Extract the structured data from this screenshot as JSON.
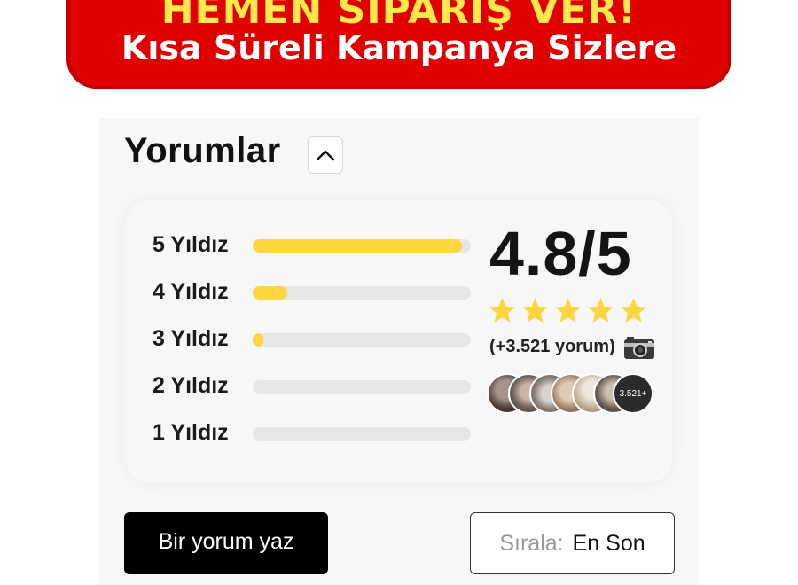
{
  "banner": {
    "line1": "HEMEN SİPARİŞ VER!",
    "line2": "Kısa Süreli Kampanya Sizlere"
  },
  "reviews": {
    "title": "Yorumlar",
    "collapse_icon": "chevron-up-icon",
    "rating_rows": [
      {
        "label": "5 Yıldız",
        "fill_fraction": 0.96
      },
      {
        "label": "4 Yıldız",
        "fill_fraction": 0.16
      },
      {
        "label": "3 Yıldız",
        "fill_fraction": 0.05
      },
      {
        "label": "2 Yıldız",
        "fill_fraction": 0.0
      },
      {
        "label": "1 Yıldız",
        "fill_fraction": 0.0
      }
    ],
    "score": "4.8/5",
    "star_count": 5,
    "review_count_text": "(+3.521 yorum)",
    "camera_icon": "camera-icon",
    "avatar_count_badge": "3.521+",
    "write_button": "Bir yorum yaz",
    "sort_label": "Sırala:",
    "sort_value": "En Son"
  },
  "colors": {
    "banner_red": "#e00000",
    "banner_yellow": "#ffe94a",
    "bar_fill": "#fcd53f",
    "star": "#fcd53f"
  }
}
